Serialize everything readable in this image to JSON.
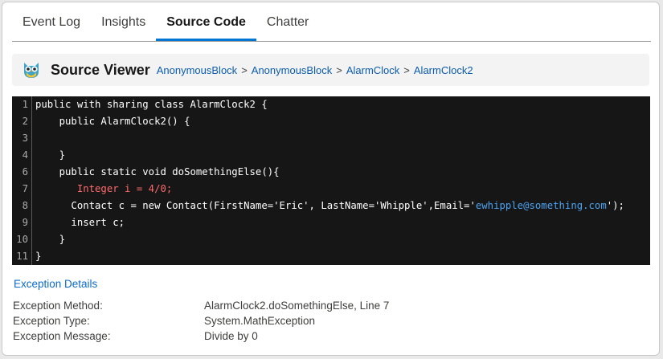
{
  "tabs": [
    {
      "label": "Event Log",
      "active": false
    },
    {
      "label": "Insights",
      "active": false
    },
    {
      "label": "Source Code",
      "active": true
    },
    {
      "label": "Chatter",
      "active": false
    }
  ],
  "viewer": {
    "title": "Source Viewer",
    "icon": "owl-icon",
    "breadcrumbs": [
      "AnonymousBlock",
      "AnonymousBlock",
      "AlarmClock",
      "AlarmClock2"
    ],
    "separator": ">"
  },
  "code": {
    "lines": [
      {
        "num": "1",
        "parts": [
          {
            "t": "public with sharing class AlarmClock2 {"
          }
        ]
      },
      {
        "num": "2",
        "parts": [
          {
            "t": "    public AlarmClock2() {"
          }
        ]
      },
      {
        "num": "3",
        "parts": [
          {
            "t": ""
          }
        ]
      },
      {
        "num": "4",
        "parts": [
          {
            "t": "    }"
          }
        ]
      },
      {
        "num": "6",
        "parts": [
          {
            "t": "    public static void doSomethingElse(){"
          }
        ]
      },
      {
        "num": "7",
        "parts": [
          {
            "t": "       Integer i = 4/0;",
            "cls": "err"
          }
        ]
      },
      {
        "num": "8",
        "parts": [
          {
            "t": "      Contact c = new Contact(FirstName='Eric', LastName='Whipple',Email='"
          },
          {
            "t": "ewhipple@something.com",
            "cls": "lnk"
          },
          {
            "t": "');"
          }
        ]
      },
      {
        "num": "9",
        "parts": [
          {
            "t": "      insert c;"
          }
        ]
      },
      {
        "num": "10",
        "parts": [
          {
            "t": "    }"
          }
        ]
      },
      {
        "num": "11",
        "parts": [
          {
            "t": "}"
          }
        ]
      }
    ]
  },
  "exception": {
    "section_title": "Exception Details",
    "method_label": "Exception Method:",
    "method_value": "AlarmClock2.doSomethingElse, Line 7",
    "type_label": "Exception Type:",
    "type_value": "System.MathException",
    "message_label": "Exception Message:",
    "message_value": "Divide by 0"
  },
  "colors": {
    "accent": "#0176d3",
    "link": "#0b5cab",
    "code_bg": "#161616",
    "error_text": "#ff6b6b"
  }
}
